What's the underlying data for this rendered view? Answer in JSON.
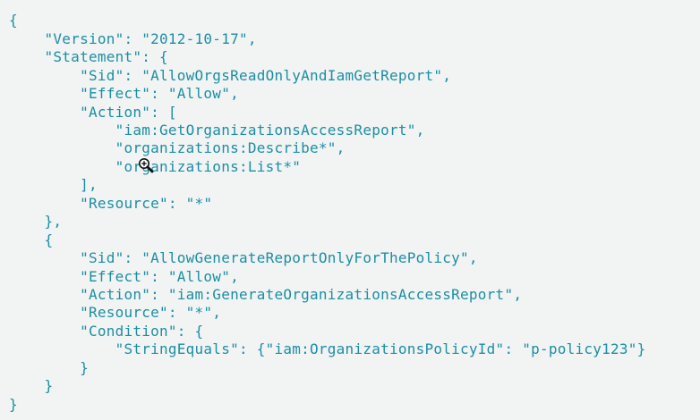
{
  "code": {
    "text_color": "#1a8fa6",
    "background_color": "#f2f3f3",
    "lines": [
      "{",
      "    \"Version\": \"2012-10-17\",",
      "    \"Statement\": {",
      "        \"Sid\": \"AllowOrgsReadOnlyAndIamGetReport\",",
      "        \"Effect\": \"Allow\",",
      "        \"Action\": [",
      "            \"iam:GetOrganizationsAccessReport\",",
      "            \"organizations:Describe*\",",
      "            \"organizations:List*\"",
      "        ],",
      "        \"Resource\": \"*\"",
      "    },",
      "    {",
      "        \"Sid\": \"AllowGenerateReportOnlyForThePolicy\",",
      "        \"Effect\": \"Allow\",",
      "        \"Action\": \"iam:GenerateOrganizationsAccessReport\",",
      "        \"Resource\": \"*\",",
      "        \"Condition\": {",
      "            \"StringEquals\": {\"iam:OrganizationsPolicyId\": \"p-policy123\"}",
      "        }",
      "    }",
      "}"
    ]
  },
  "cursor": {
    "icon": "zoom-in-cursor-icon"
  }
}
